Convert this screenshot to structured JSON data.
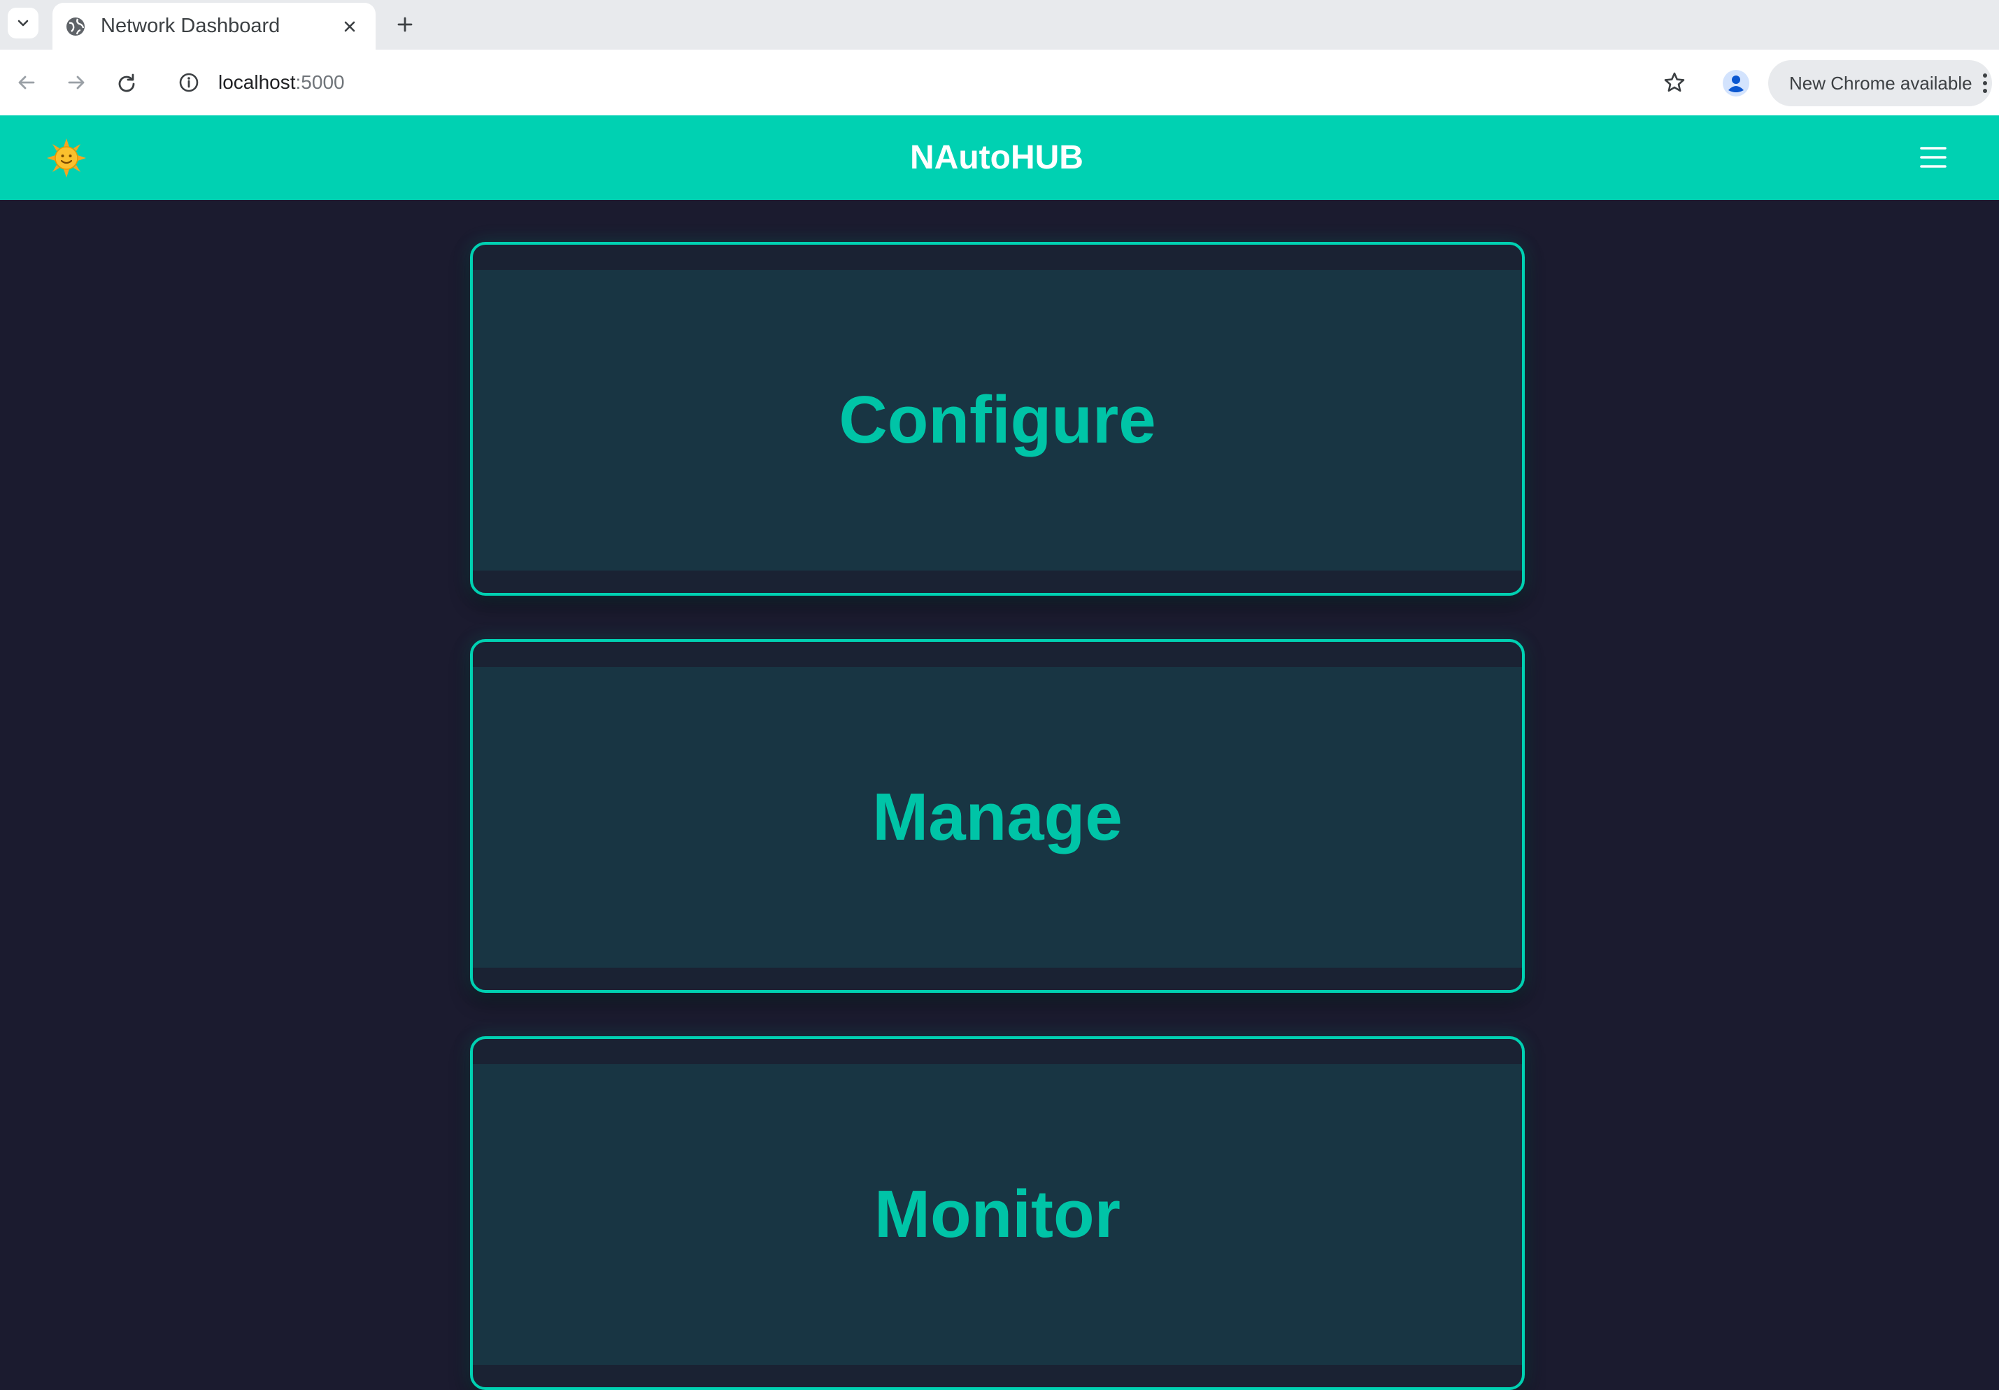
{
  "browser": {
    "tab_title": "Network Dashboard",
    "url_host": "localhost",
    "url_port": ":5000",
    "update_label": "New Chrome available"
  },
  "app": {
    "title": "NAutoHUB",
    "theme_icon": "sun-emoji",
    "menu_icon": "hamburger-icon",
    "brand_color": "#00d1b2",
    "background_color": "#1b1b2f"
  },
  "cards": [
    {
      "label": "Configure"
    },
    {
      "label": "Manage"
    },
    {
      "label": "Monitor"
    }
  ]
}
